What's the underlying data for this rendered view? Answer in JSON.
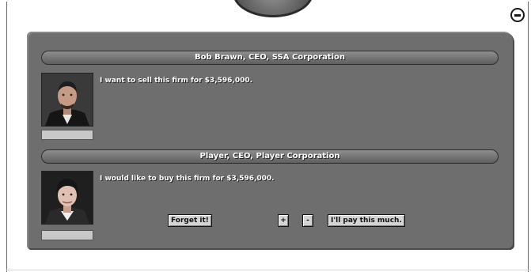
{
  "seller": {
    "name_bar": "Bob Brawn, CEO, SSA Corporation",
    "message": "I want to sell this firm for $3,596,000."
  },
  "buyer": {
    "name_bar": "Player, CEO, Player Corporation",
    "message": "I would like to buy this firm for $3,596,000."
  },
  "buttons": {
    "forget": "Forget it!",
    "increase": "+",
    "decrease": "-",
    "pay": "I'll pay this much."
  },
  "icons": {
    "minimize": "minimize-icon",
    "seller_portrait": "seller-portrait",
    "buyer_portrait": "player-portrait"
  }
}
